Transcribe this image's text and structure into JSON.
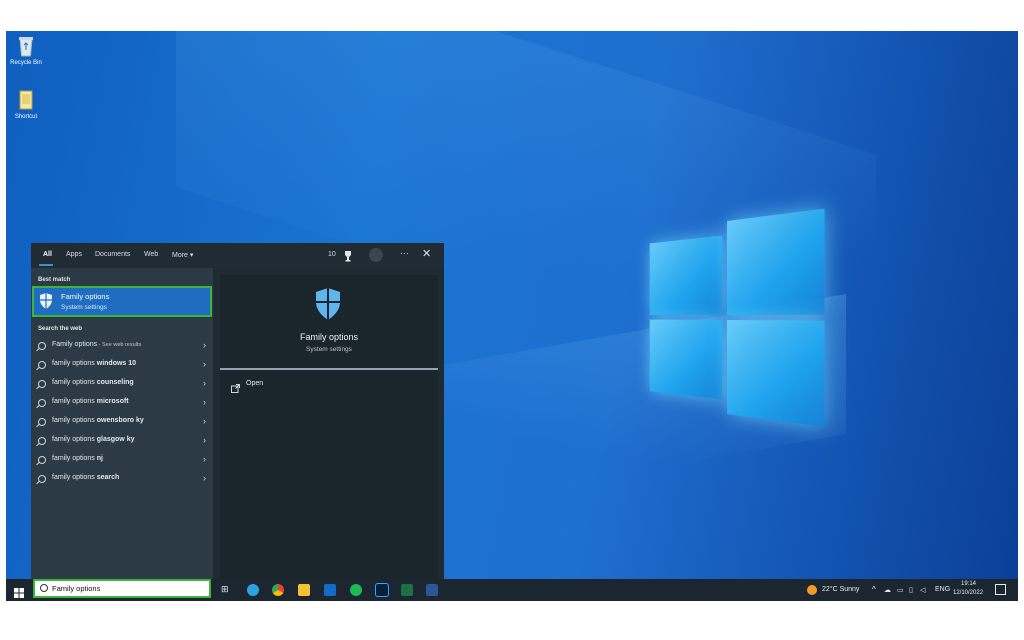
{
  "desktop": {
    "icons": [
      {
        "label": "Recycle Bin",
        "icon": "recycle-bin-icon"
      },
      {
        "label": "Shortcut",
        "icon": "file-shortcut-icon"
      }
    ]
  },
  "start_search": {
    "tabs": [
      "All",
      "Apps",
      "Documents",
      "Web",
      "More ▾"
    ],
    "active_tab": "All",
    "points": "10",
    "best_match_header": "Best match",
    "best_match": {
      "title": "Family options",
      "subtitle": "System settings",
      "icon": "shield-icon"
    },
    "web_header": "Search the web",
    "web_results": [
      {
        "prefix": "Family options",
        "suffix": " - See web results"
      },
      {
        "prefix": "family options ",
        "suffix": "windows 10"
      },
      {
        "prefix": "family options ",
        "suffix": "counseling"
      },
      {
        "prefix": "family options ",
        "suffix": "microsoft"
      },
      {
        "prefix": "family options ",
        "suffix": "owensboro ky"
      },
      {
        "prefix": "family options ",
        "suffix": "glasgow ky"
      },
      {
        "prefix": "family options ",
        "suffix": "nj"
      },
      {
        "prefix": "family options ",
        "suffix": "search"
      }
    ],
    "detail": {
      "title": "Family options",
      "subtitle": "System settings",
      "open_label": "Open"
    }
  },
  "taskbar": {
    "search_value": "Family options",
    "weather": "22°C  Sunny",
    "language": "ENG",
    "time": "19:14",
    "date": "12/10/2022",
    "colors": {
      "accent": "#1e6dc0",
      "highlight": "#3fb43a"
    }
  }
}
